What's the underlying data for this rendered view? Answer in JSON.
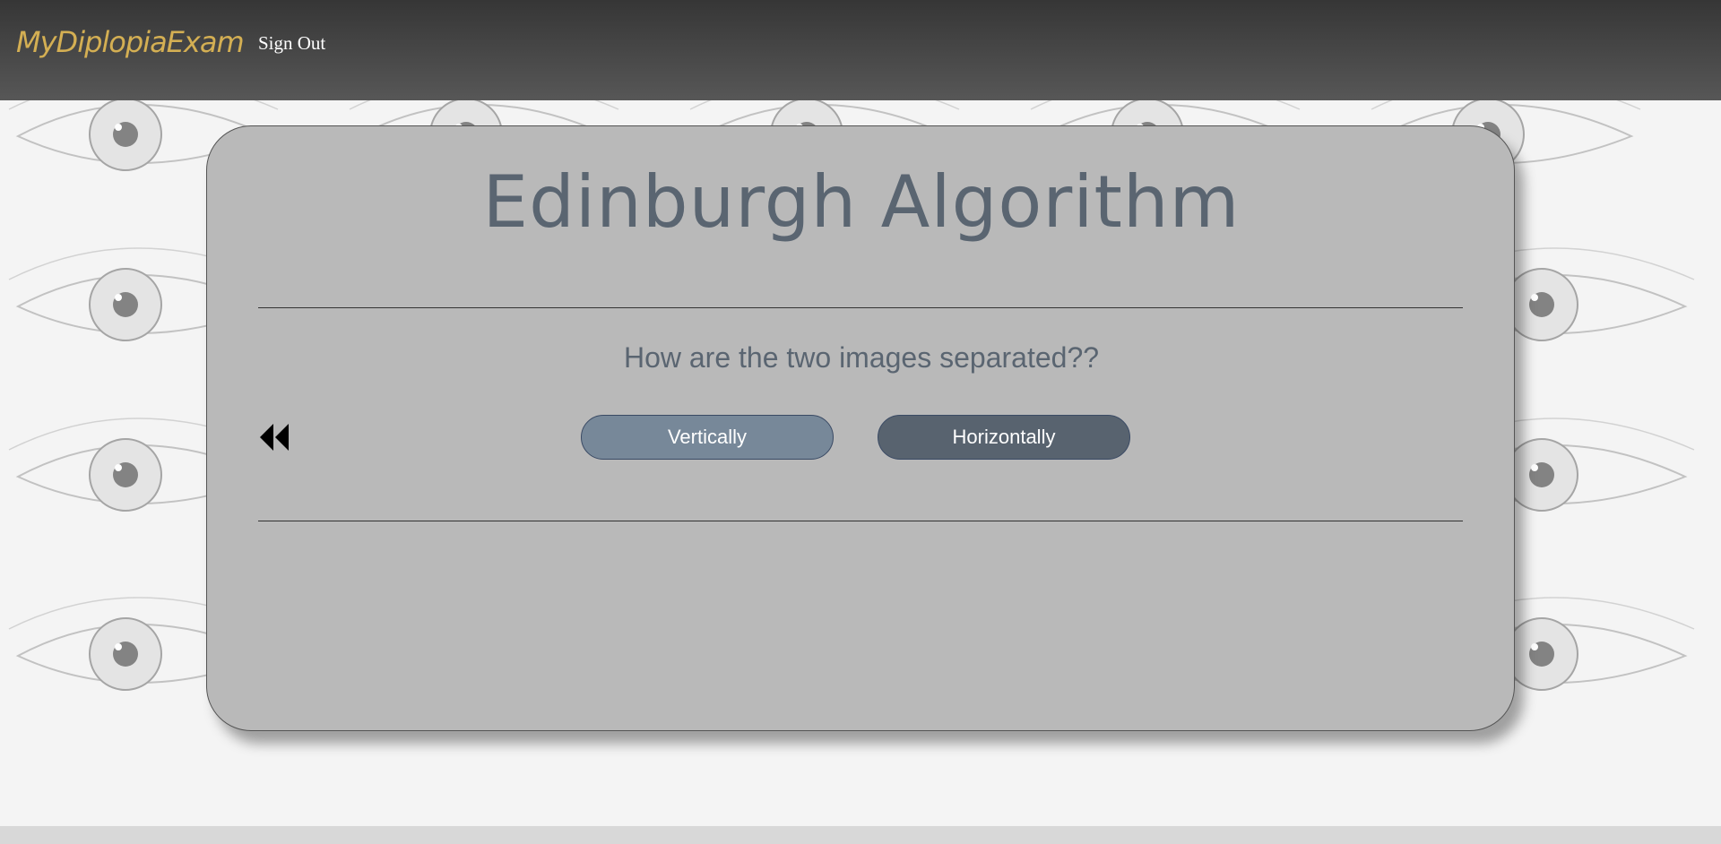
{
  "navbar": {
    "brand": "MyDiplopiaExam",
    "sign_out": "Sign Out"
  },
  "card": {
    "title": "Edinburgh Algorithm",
    "question": "How are the two images separated??",
    "back_icon": "rewind-icon",
    "options": [
      {
        "label": "Vertically"
      },
      {
        "label": "Horizontally"
      }
    ]
  },
  "colors": {
    "navbar_top": "#363636",
    "navbar_bottom": "#575757",
    "brand": "#d4af53",
    "card_bg": "#b9b9b9",
    "title_text": "#5a6571",
    "btn_vertical": "#778899",
    "btn_horizontal": "#58636f"
  },
  "background": "sketched-eyes-pattern"
}
